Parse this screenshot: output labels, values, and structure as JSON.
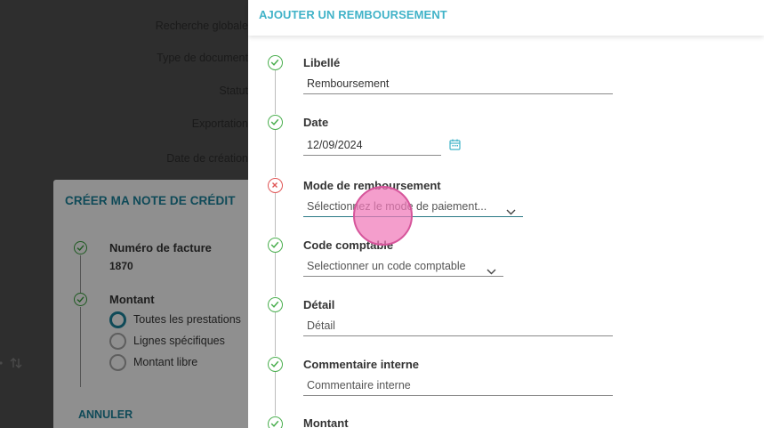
{
  "background": {
    "filters": [
      "Recherche globale",
      "Type de document",
      "Statut",
      "Exportation",
      "Date de création"
    ],
    "sort_icon": "sort-arrows-icon"
  },
  "credit_modal": {
    "title": "CRÉER MA NOTE DE CRÉDIT",
    "invoice_label": "Numéro de facture",
    "invoice_value": "1870",
    "amount_label": "Montant",
    "options": [
      "Toutes les prestations",
      "Lignes spécifiques",
      "Montant libre"
    ],
    "selected_option": "Toutes les prestations",
    "cancel_label": "ANNULER"
  },
  "drawer": {
    "title": "AJOUTER UN REMBOURSEMENT",
    "accent_color": "#41b3c8",
    "fields": {
      "libelle": {
        "label": "Libellé",
        "value": "Remboursement"
      },
      "date": {
        "label": "Date",
        "value": "12/09/2024",
        "icon": "calendar-icon"
      },
      "mode": {
        "label": "Mode de remboursement",
        "placeholder": "Sélectionnez le mode de paiement...",
        "status": "error"
      },
      "code": {
        "label": "Code comptable",
        "placeholder": "Selectionner un code comptable"
      },
      "detail": {
        "label": "Détail",
        "placeholder": "Détail"
      },
      "commentaire": {
        "label": "Commentaire interne",
        "placeholder": "Commentaire interne"
      },
      "montant": {
        "label": "Montant"
      }
    }
  }
}
